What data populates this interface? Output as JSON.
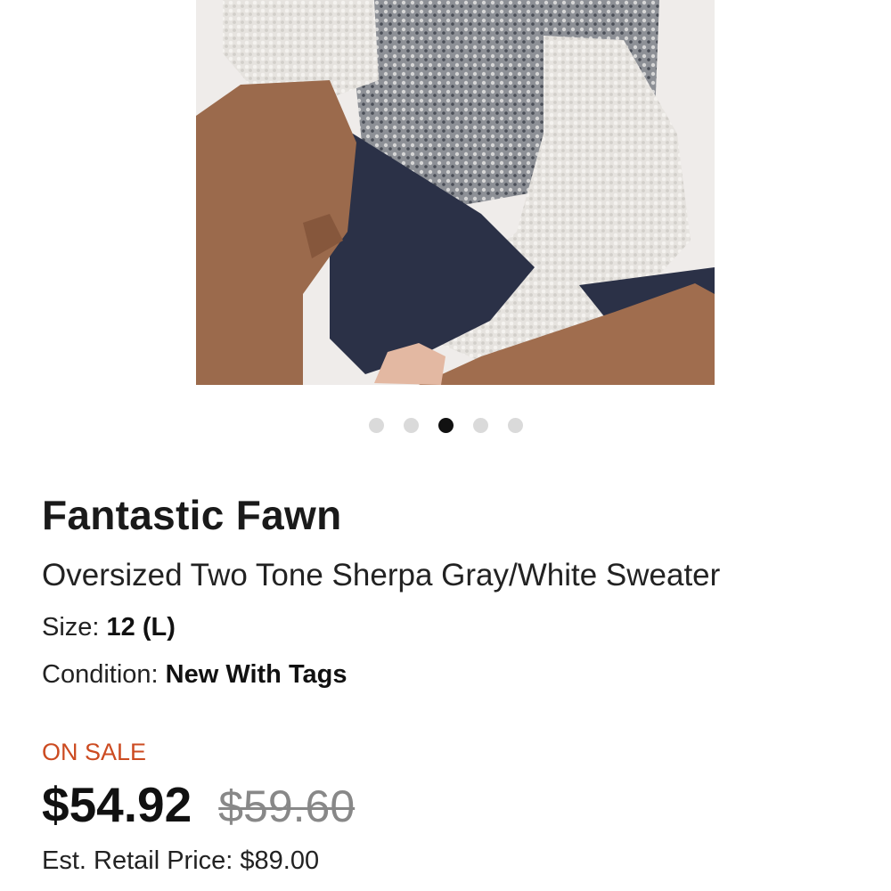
{
  "carousel": {
    "image_alt": "product-photo",
    "dot_count": 5,
    "active_index": 2
  },
  "product": {
    "brand": "Fantastic Fawn",
    "title": "Oversized Two Tone Sherpa Gray/White Sweater",
    "size_label": "Size:",
    "size_value": "12 (L)",
    "condition_label": "Condition:",
    "condition_value": "New With Tags"
  },
  "pricing": {
    "sale_badge": "ON SALE",
    "price": "$54.92",
    "original_price": "$59.60",
    "retail_label": "Est. Retail Price:",
    "retail_value": "$89.00"
  },
  "colors": {
    "sale": "#cc4b21",
    "dot_active": "#111111",
    "dot_inactive": "#dadada"
  }
}
